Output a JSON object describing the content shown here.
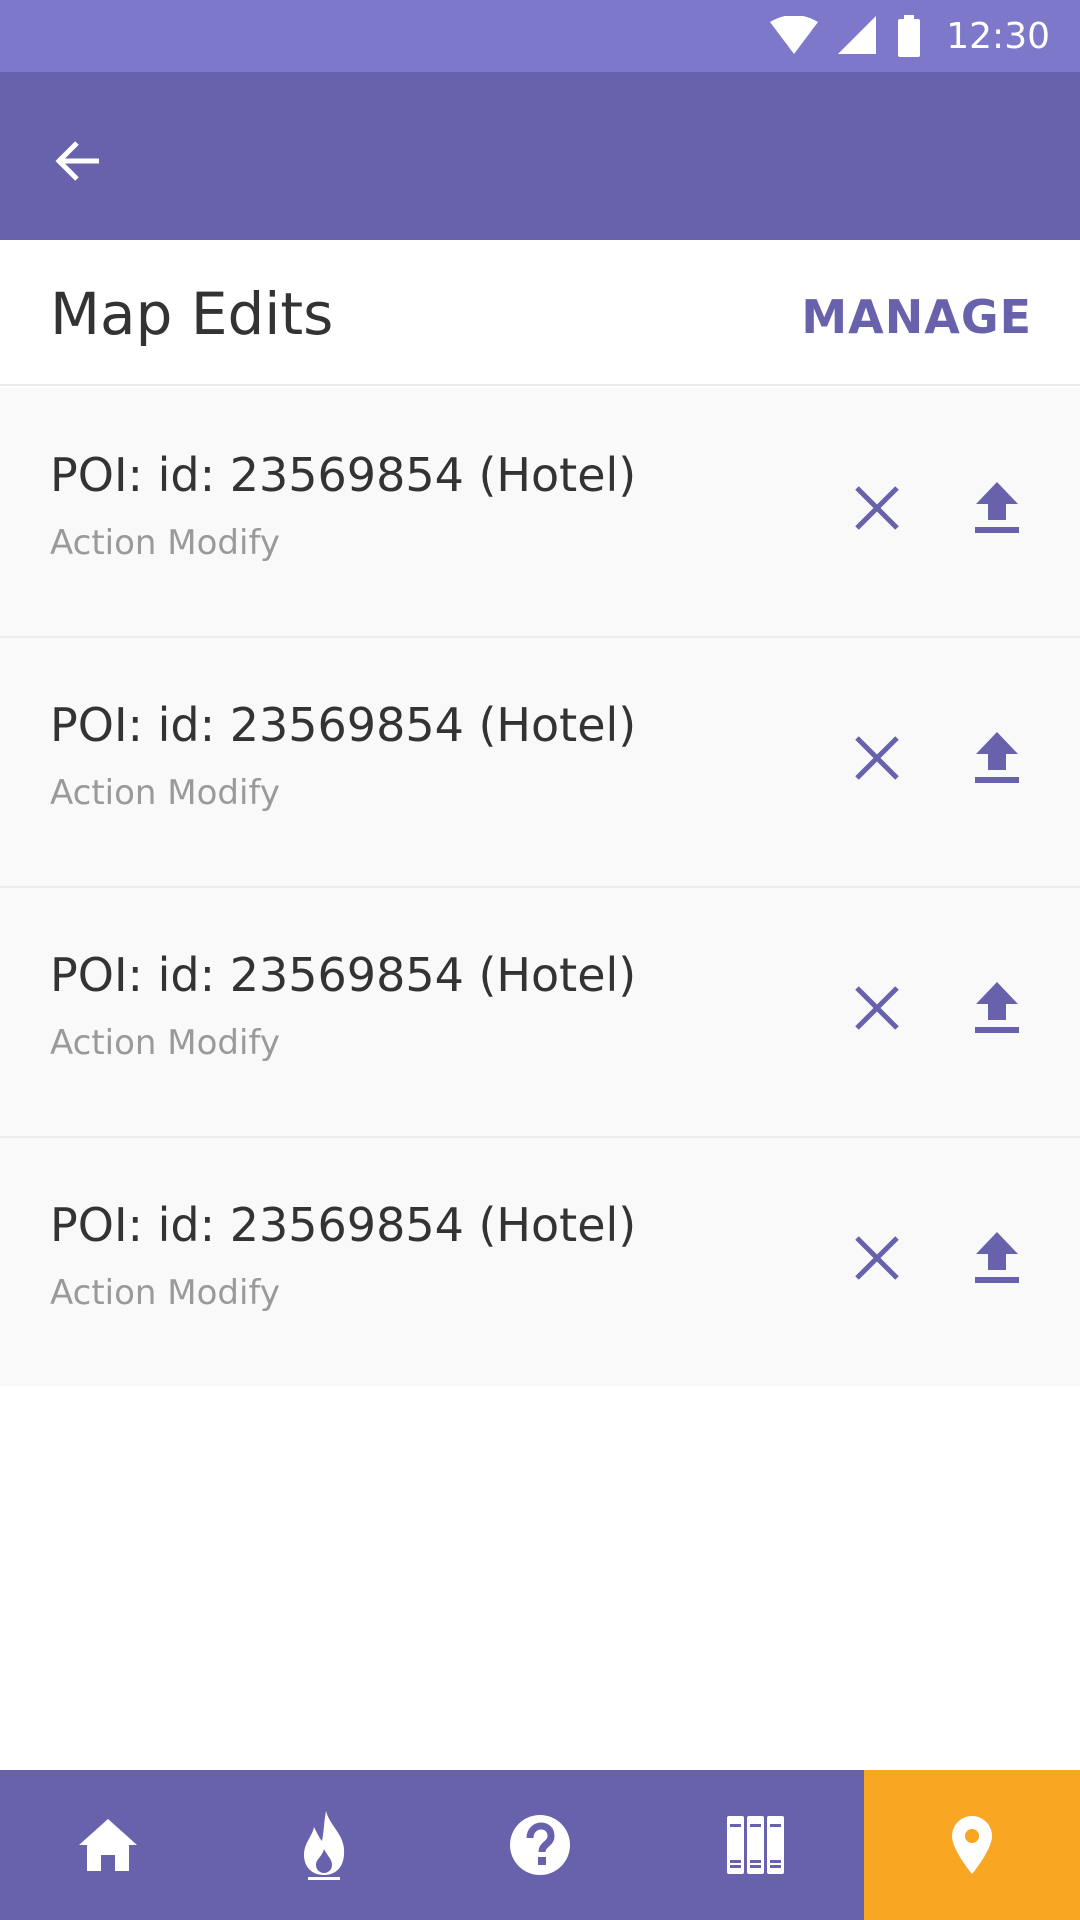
{
  "status_bar": {
    "time": "12:30",
    "icons": [
      "wifi-icon",
      "signal-icon",
      "battery-icon"
    ]
  },
  "app_bar": {
    "back_icon": "arrow-back-icon"
  },
  "section": {
    "title": "Map Edits",
    "manage_label": "MANAGE"
  },
  "edits": [
    {
      "title": "POI: id: 23569854 (Hotel)",
      "subtitle": "Action Modify"
    },
    {
      "title": "POI: id: 23569854 (Hotel)",
      "subtitle": "Action Modify"
    },
    {
      "title": "POI: id: 23569854 (Hotel)",
      "subtitle": "Action Modify"
    },
    {
      "title": "POI: id: 23569854 (Hotel)",
      "subtitle": "Action Modify"
    }
  ],
  "bottom_nav": {
    "items": [
      "home-icon",
      "flame-icon",
      "help-icon",
      "books-icon",
      "map-pin-icon"
    ],
    "active": "map-pin-icon"
  },
  "colors": {
    "status_bar": "#7e78cb",
    "primary": "#6862ac",
    "accent": "#f9a623",
    "row_background": "#f9f9f9",
    "text_primary": "#333333",
    "text_secondary": "#9a9a9a"
  }
}
